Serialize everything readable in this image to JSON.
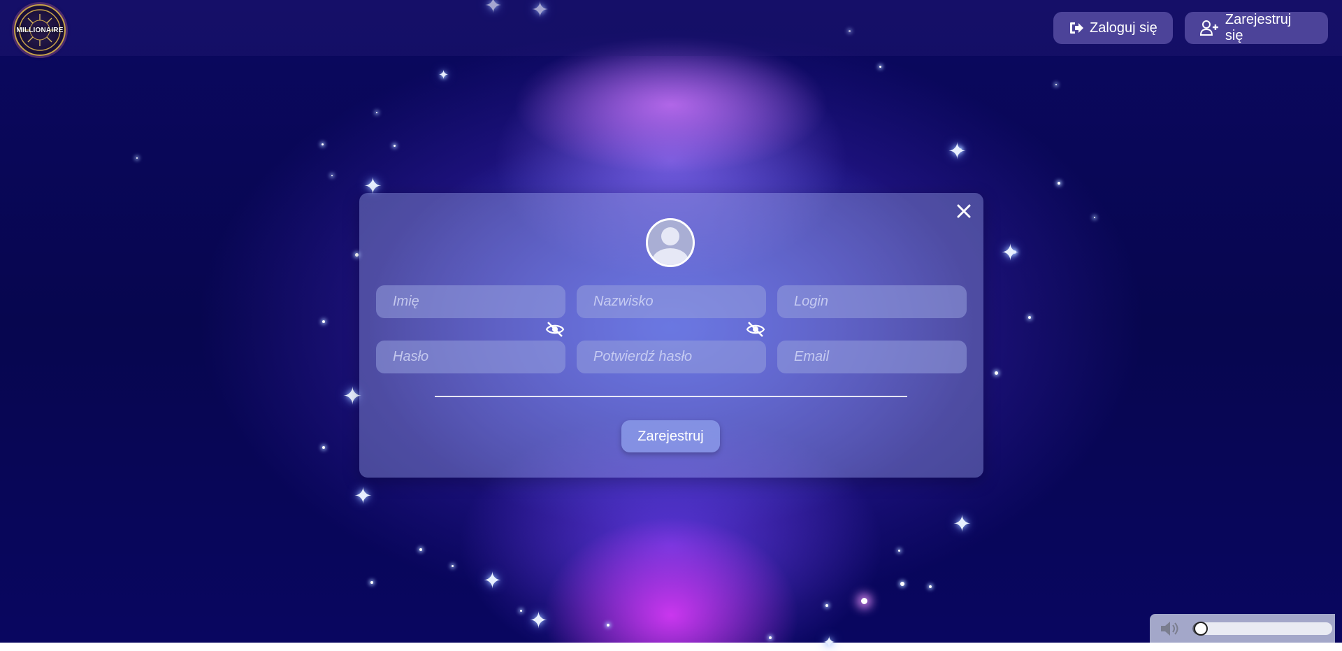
{
  "header": {
    "logo_text": "MILLIONAIRE",
    "login_label": "Zaloguj się",
    "register_label": "Zarejestruj się"
  },
  "form": {
    "fields": {
      "first_name": {
        "placeholder": "Imię",
        "value": ""
      },
      "last_name": {
        "placeholder": "Nazwisko",
        "value": ""
      },
      "login": {
        "placeholder": "Login",
        "value": ""
      },
      "password": {
        "placeholder": "Hasło",
        "value": ""
      },
      "confirm_password": {
        "placeholder": "Potwierdź hasło",
        "value": ""
      },
      "email": {
        "placeholder": "Email",
        "value": ""
      }
    },
    "submit_label": "Zarejestruj"
  },
  "volume": {
    "level": 0.0
  },
  "colors": {
    "background_dark": "#07064f",
    "glow_purple": "#d678ff",
    "button_bg": "#5f55aa",
    "modal_bg": "#969fe1",
    "text": "#ffffff"
  },
  "icons": {
    "login": "sign-in-icon",
    "register": "user-plus-icon",
    "close": "close-icon",
    "avatar": "user-avatar-icon",
    "password_toggle": "eye-slash-icon",
    "volume": "speaker-icon"
  }
}
